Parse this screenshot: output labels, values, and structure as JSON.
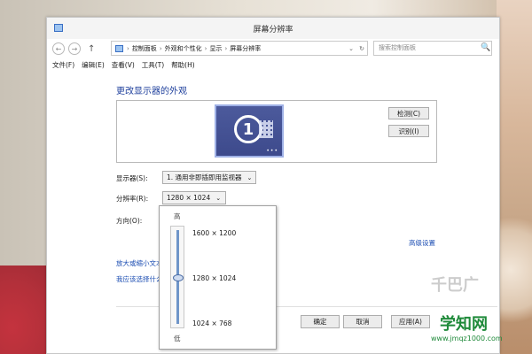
{
  "window": {
    "title": "屏幕分辨率"
  },
  "address": {
    "crumbs": [
      "控制面板",
      "外观和个性化",
      "显示",
      "屏幕分辨率"
    ],
    "separator": "›",
    "dropdown_icon": "chevron-down-icon",
    "refresh_icon": "refresh-icon"
  },
  "nav": {
    "back": "←",
    "forward": "→",
    "up": "↑"
  },
  "search": {
    "placeholder": "搜索控制面板",
    "icon": "🔍"
  },
  "menu": {
    "items": [
      "文件(F)",
      "编辑(E)",
      "查看(V)",
      "工具(T)",
      "帮助(H)"
    ]
  },
  "main": {
    "heading": "更改显示器的外观",
    "monitor_number": "1",
    "monitor_dots": "•••",
    "detect_button": "检测(C)",
    "identify_button": "识别(I)",
    "display_label": "显示器(S):",
    "display_value": "1. 通用非即插即用监视器",
    "resolution_label": "分辨率(R):",
    "resolution_value": "1280 × 1024",
    "orientation_label": "方向(O):",
    "advanced_link": "高级设置",
    "link1": "放大或缩小文本",
    "link2": "我应该选择什么"
  },
  "buttons": {
    "ok": "确定",
    "cancel": "取消",
    "apply": "应用(A)"
  },
  "popup": {
    "high": "高",
    "low": "低",
    "options": [
      "1600 × 1200",
      "1280 × 1024",
      "1024 × 768"
    ],
    "selected_index": 1
  },
  "watermark": {
    "site": "学知网",
    "url": "www.jmqz1000.com",
    "faint": "千巴广"
  },
  "colors": {
    "accent": "#1e3f9c",
    "link": "#1e4fb3",
    "monitor": "#3d4a8c"
  }
}
